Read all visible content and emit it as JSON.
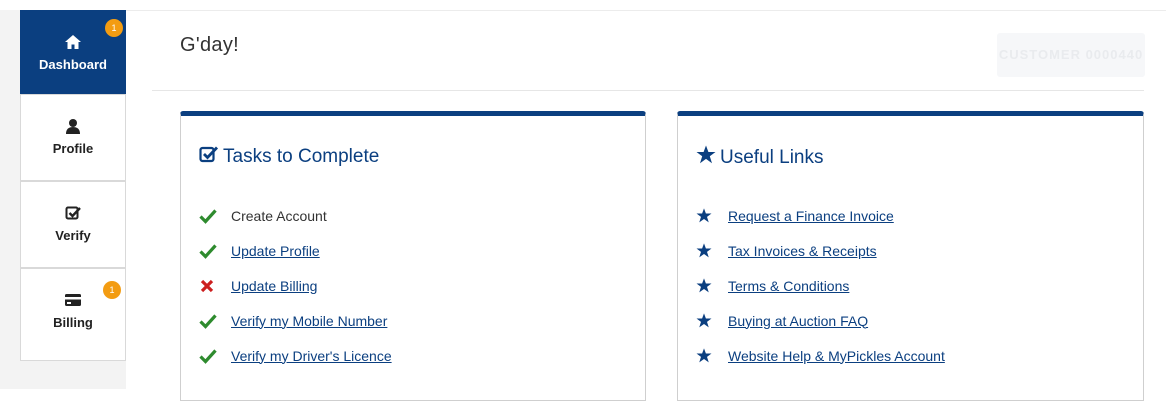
{
  "sidebar": {
    "items": [
      {
        "label": "Dashboard",
        "icon": "home-icon",
        "badge": "1",
        "active": true
      },
      {
        "label": "Profile",
        "icon": "user-icon"
      },
      {
        "label": "Verify",
        "icon": "check-square-icon"
      },
      {
        "label": "Billing",
        "icon": "credit-card-icon",
        "badge": "1"
      }
    ]
  },
  "main": {
    "greeting": "G'day!",
    "customer_button": "CUSTOMER 0000440"
  },
  "tasks": {
    "title": "Tasks to Complete",
    "items": [
      {
        "label": "Create Account",
        "status": "done",
        "link": false
      },
      {
        "label": "Update Profile",
        "status": "done",
        "link": true
      },
      {
        "label": "Update Billing",
        "status": "pending",
        "link": true
      },
      {
        "label": "Verify my Mobile Number",
        "status": "done",
        "link": true
      },
      {
        "label": "Verify my Driver's Licence",
        "status": "done",
        "link": true
      }
    ]
  },
  "links": {
    "title": "Useful Links",
    "items": [
      {
        "label": "Request a Finance Invoice"
      },
      {
        "label": "Tax Invoices & Receipts"
      },
      {
        "label": "Terms & Conditions"
      },
      {
        "label": "Buying at Auction FAQ"
      },
      {
        "label": "Website Help & MyPickles Account"
      }
    ]
  },
  "colors": {
    "brand": "#0b3f80",
    "badge": "#f39c12",
    "done": "#2e8b2e",
    "pending": "#cc1f1f"
  }
}
